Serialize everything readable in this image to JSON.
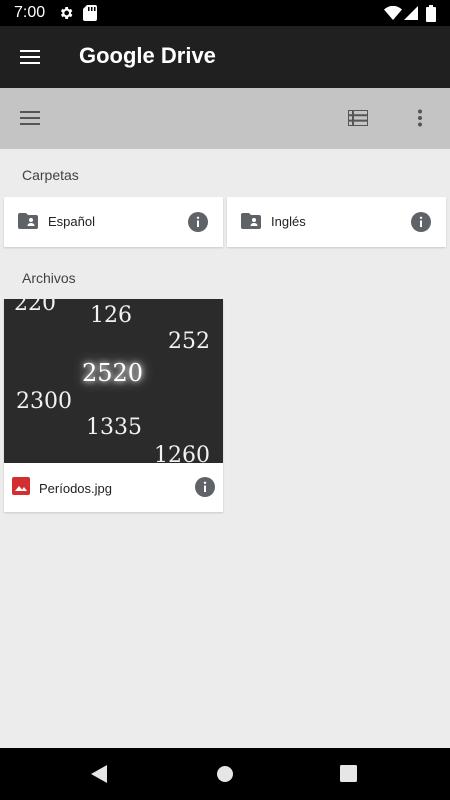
{
  "status_bar": {
    "time": "7:00"
  },
  "app_bar": {
    "title": "Google Drive"
  },
  "sections": {
    "folders_label": "Carpetas",
    "files_label": "Archivos"
  },
  "folders": [
    {
      "name": "Español"
    },
    {
      "name": "Inglés"
    }
  ],
  "files": [
    {
      "name": "Períodos.jpg",
      "thumbnail_numbers": [
        "220",
        "126",
        "252",
        "2520",
        "2300",
        "1335",
        "1260"
      ]
    }
  ],
  "colors": {
    "status_bar": "#000000",
    "app_bar": "#202020",
    "toolbar": "#c4c4c4",
    "background": "#ececec",
    "image_icon": "#d32f2f"
  }
}
